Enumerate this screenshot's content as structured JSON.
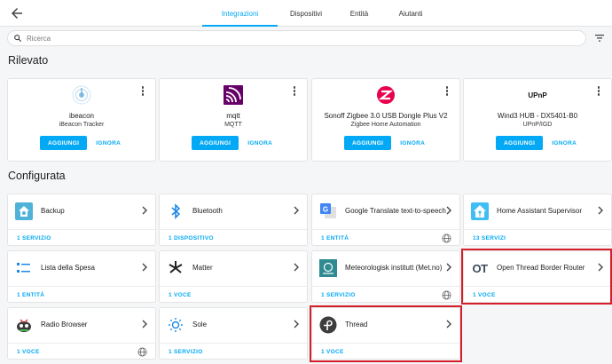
{
  "tabs": [
    {
      "label": "Integrazioni",
      "active": true
    },
    {
      "label": "Dispositivi",
      "active": false
    },
    {
      "label": "Entità",
      "active": false
    },
    {
      "label": "Aiutanti",
      "active": false
    }
  ],
  "search": {
    "placeholder": "Ricerca"
  },
  "sections": {
    "discovered": "Rilevato",
    "configured": "Configurata"
  },
  "discovered": [
    {
      "name": "ibeacon",
      "sub": "iBeacon Tracker",
      "icon": "ibeacon-icon",
      "add": "AGGIUNGI",
      "ignore": "IGNORA"
    },
    {
      "name": "mqtt",
      "sub": "MQTT",
      "icon": "mqtt-icon",
      "add": "AGGIUNGI",
      "ignore": "IGNORA"
    },
    {
      "name": "Sonoff Zigbee 3.0 USB Dongle Plus V2",
      "sub": "Zigbee Home Automation",
      "icon": "zigbee-icon",
      "add": "AGGIUNGI",
      "ignore": "IGNORA"
    },
    {
      "name": "Wind3 HUB - DX5401-B0",
      "sub": "UPnP/IGD",
      "icon": "upnp-icon",
      "logo_text": "UPnP",
      "add": "AGGIUNGI",
      "ignore": "IGNORA"
    }
  ],
  "configured": [
    {
      "name": "Backup",
      "footer": "1 SERVIZIO",
      "icon": "backup-icon",
      "cloud": false
    },
    {
      "name": "Bluetooth",
      "footer": "1 DISPOSITIVO",
      "icon": "bluetooth-icon",
      "cloud": false
    },
    {
      "name": "Google Translate text-to-speech",
      "footer": "1 ENTITÀ",
      "icon": "google-translate-icon",
      "cloud": true
    },
    {
      "name": "Home Assistant Supervisor",
      "footer": "13 SERVIZI",
      "icon": "home-assistant-icon",
      "cloud": false
    },
    {
      "name": "Lista della Spesa",
      "footer": "1 ENTITÀ",
      "icon": "shopping-list-icon",
      "cloud": false
    },
    {
      "name": "Matter",
      "footer": "1 VOCE",
      "icon": "matter-icon",
      "cloud": false
    },
    {
      "name": "Meteorologisk institutt (Met.no)",
      "footer": "1 SERVIZIO",
      "icon": "met-no-icon",
      "cloud": true
    },
    {
      "name": "Open Thread Border Router",
      "footer": "1 VOCE",
      "icon": "otbr-icon",
      "logo_text": "OT",
      "cloud": false
    },
    {
      "name": "Radio Browser",
      "footer": "1 VOCE",
      "icon": "radio-browser-icon",
      "cloud": true
    },
    {
      "name": "Sole",
      "footer": "1 SERVIZIO",
      "icon": "sun-icon",
      "cloud": false
    },
    {
      "name": "Thread",
      "footer": "1 VOCE",
      "icon": "thread-icon",
      "cloud": false
    }
  ],
  "colors": {
    "accent": "#03a9f4",
    "highlight": "#d41f2a",
    "background": "#f5f6f7"
  }
}
